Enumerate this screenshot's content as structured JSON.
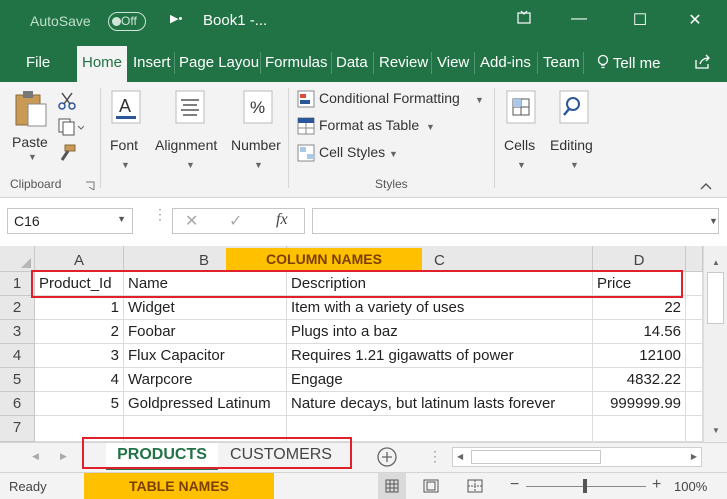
{
  "titlebar": {
    "autosave_label": "AutoSave",
    "autosave_state": "Off",
    "doc_title": "Book1  -...",
    "minimize_glyph": "—",
    "restore_glyph": "☐",
    "close_glyph": "✕",
    "ribbon_display_icon": "ribbon-display-icon"
  },
  "tabs": [
    "File",
    "Home",
    "Insert",
    "Page Layou",
    "Formulas",
    "Data",
    "Review",
    "View",
    "Add-ins",
    "Team"
  ],
  "tell_me": "Tell me",
  "ribbon": {
    "paste": "Paste",
    "clipboard": "Clipboard",
    "font": "Font",
    "alignment": "Alignment",
    "number": "Number",
    "conditional_formatting": "Conditional Formatting",
    "format_as_table": "Format as Table",
    "cell_styles": "Cell Styles",
    "styles": "Styles",
    "cells": "Cells",
    "editing": "Editing"
  },
  "formula_bar": {
    "name_box": "C16",
    "cancel_glyph": "✕",
    "enter_glyph": "✓",
    "fx": "fx",
    "formula": ""
  },
  "columns": [
    "A",
    "B",
    "C",
    "D"
  ],
  "rows": [
    "1",
    "2",
    "3",
    "4",
    "5",
    "6",
    "7"
  ],
  "table": {
    "header": [
      "Product_Id",
      "Name",
      "Description",
      "Price"
    ],
    "rows": [
      [
        "1",
        "Widget",
        "Item with a variety of uses",
        "22"
      ],
      [
        "2",
        "Foobar",
        "Plugs into a baz",
        "14.56"
      ],
      [
        "3",
        "Flux Capacitor",
        "Requires 1.21 gigawatts of power",
        "12100"
      ],
      [
        "4",
        "Warpcore",
        "Engage",
        "4832.22"
      ],
      [
        "5",
        "Goldpressed Latinum",
        "Nature decays, but latinum lasts forever",
        "999999.99"
      ]
    ]
  },
  "annotations": {
    "column_names": "COLUMN NAMES",
    "table_names": "TABLE NAMES"
  },
  "sheets": [
    "PRODUCTS",
    "CUSTOMERS"
  ],
  "active_sheet": "PRODUCTS",
  "status": {
    "ready": "Ready",
    "zoom": "100%",
    "zoom_minus": "−",
    "zoom_plus": "+"
  },
  "colors": {
    "brand_green": "#217346",
    "highlight_yellow": "#ffc000",
    "annotation_red": "#e0202a"
  }
}
